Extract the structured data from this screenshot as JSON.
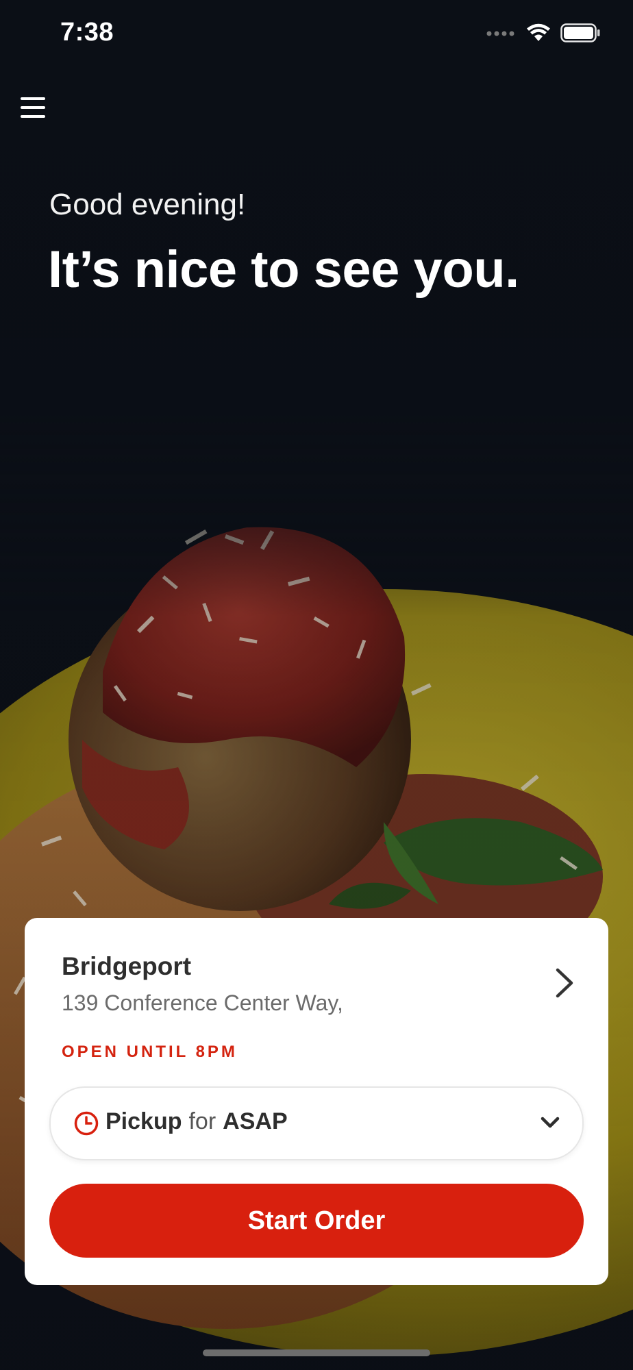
{
  "status_bar": {
    "time": "7:38",
    "icons": [
      "signal-dots-icon",
      "wifi-icon",
      "battery-icon"
    ]
  },
  "header": {
    "menu_icon": "hamburger-menu-icon"
  },
  "greeting": {
    "subtitle": "Good evening!",
    "headline": "It’s nice to see you."
  },
  "location": {
    "name": "Bridgeport",
    "address": "139 Conference Center Way,",
    "hours": "OPEN UNTIL 8PM",
    "chevron_icon": "chevron-right-icon"
  },
  "order_mode": {
    "icon": "clock-icon",
    "mode": "Pickup",
    "connector": "for",
    "time": "ASAP",
    "dropdown_icon": "chevron-down-icon"
  },
  "actions": {
    "start_order_label": "Start Order"
  },
  "colors": {
    "accent": "#d8200e",
    "background": "#0b0f16",
    "plate": "#b8a417",
    "card": "#ffffff"
  }
}
